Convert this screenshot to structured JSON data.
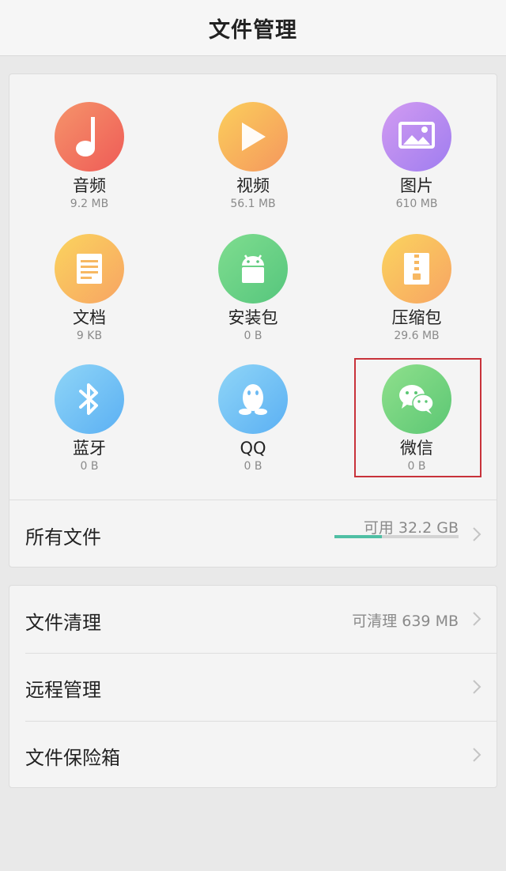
{
  "header": {
    "title": "文件管理"
  },
  "categories": [
    {
      "name": "音频",
      "size": "9.2 MB",
      "icon": "music-note-icon"
    },
    {
      "name": "视频",
      "size": "56.1 MB",
      "icon": "play-icon"
    },
    {
      "name": "图片",
      "size": "610 MB",
      "icon": "image-icon"
    },
    {
      "name": "文档",
      "size": "9 KB",
      "icon": "document-icon"
    },
    {
      "name": "安装包",
      "size": "0 B",
      "icon": "android-icon"
    },
    {
      "name": "压缩包",
      "size": "29.6 MB",
      "icon": "zip-icon"
    },
    {
      "name": "蓝牙",
      "size": "0 B",
      "icon": "bluetooth-icon"
    },
    {
      "name": "QQ",
      "size": "0 B",
      "icon": "qq-penguin-icon"
    },
    {
      "name": "微信",
      "size": "0 B",
      "icon": "wechat-icon"
    }
  ],
  "all_files": {
    "label": "所有文件",
    "available": "可用 32.2 GB",
    "used_fraction": 0.38
  },
  "tools": [
    {
      "label": "文件清理",
      "value": "可清理 639 MB"
    },
    {
      "label": "远程管理",
      "value": ""
    },
    {
      "label": "文件保险箱",
      "value": ""
    }
  ],
  "colors": {
    "highlight_border": "#c8323a",
    "storage_bar_fill": "#4fbfa4"
  }
}
